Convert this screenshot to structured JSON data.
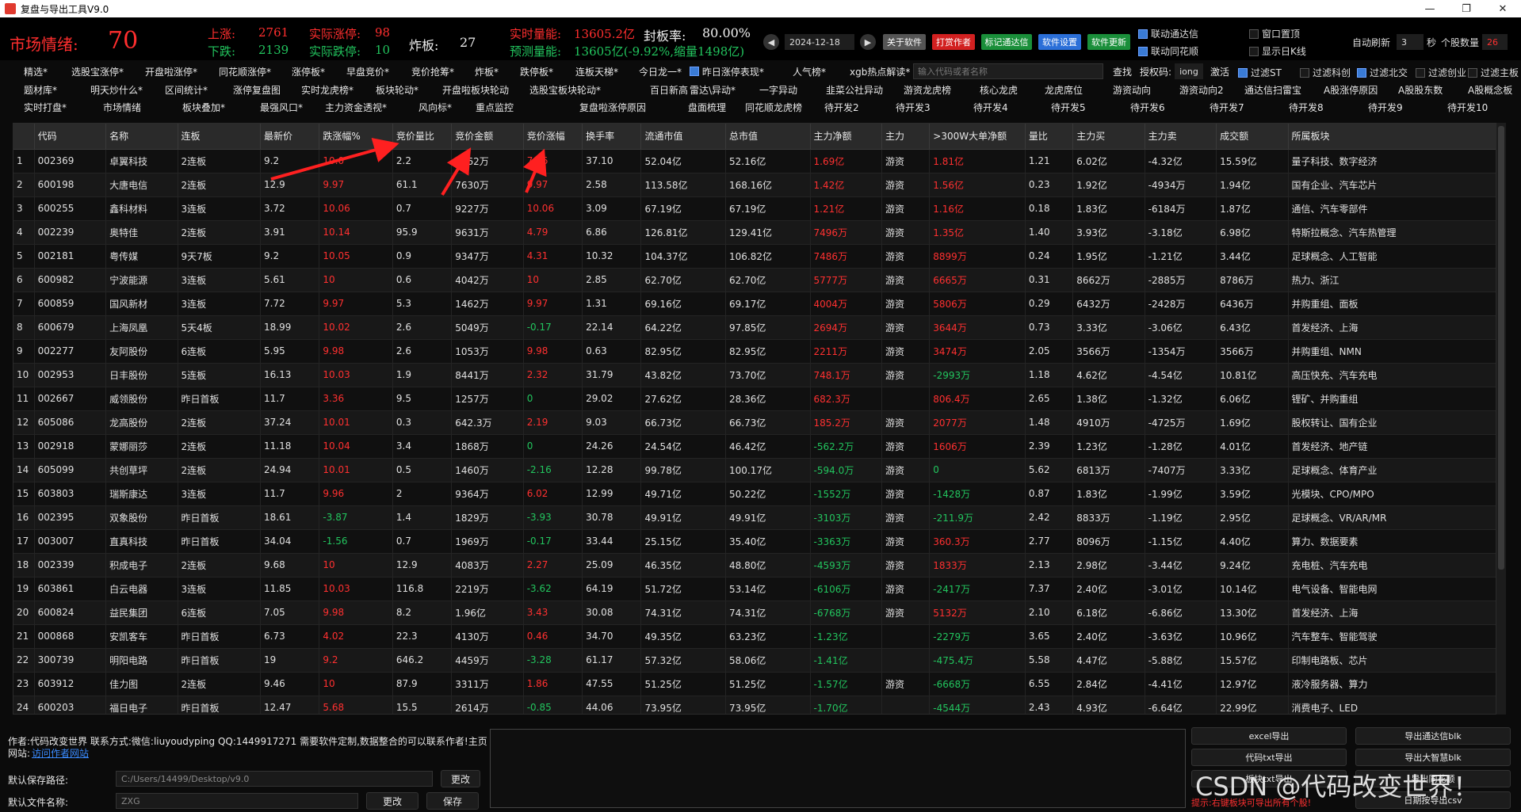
{
  "window": {
    "title": "复盘与导出工具V9.0"
  },
  "header": {
    "mood_label": "市场情绪:",
    "mood_value": "70",
    "rise_label": "上涨:",
    "rise_value": "2761",
    "fall_label": "下跌:",
    "fall_value": "2139",
    "limit_up_label": "实际涨停:",
    "limit_up_value": "98",
    "limit_down_label": "实际跌停:",
    "limit_down_value": "10",
    "broken_label": "炸板:",
    "broken_value": "27",
    "volume_label": "实时量能:",
    "volume_value": "13605.2亿",
    "seal_label": "封板率:",
    "seal_value": "80.00%",
    "forecast_label": "预测量能:",
    "forecast_value": "13605亿(-9.92%,缩量1498亿)",
    "date": "2024-12-18",
    "buttons": [
      "关于软件",
      "打赏作者",
      "标记通达信",
      "软件设置",
      "软件更新"
    ],
    "checks": [
      {
        "label": "联动通达信",
        "on": true
      },
      {
        "label": "联动同花顺",
        "on": true
      },
      {
        "label": "窗口置顶",
        "on": false
      },
      {
        "label": "显示日K线",
        "on": false
      }
    ],
    "auto_refresh_label": "自动刷新",
    "auto_refresh_value": "3",
    "auto_refresh_unit": "秒",
    "stock_count_label": "个股数量",
    "stock_count_value": "26"
  },
  "toolbar1": [
    "精选*",
    "选股宝涨停*",
    "开盘啦涨停*",
    "同花顺涨停*",
    "涨停板*",
    "早盘竞价*",
    "竞价抢筹*",
    "炸板*",
    "跌停板*",
    "连板天梯*",
    "今日龙一*",
    "昨日涨停表现*",
    "人气榜*",
    "xgb热点解读*"
  ],
  "search": {
    "placeholder": "输入代码或者名称",
    "find": "查找",
    "auth_label": "授权码:",
    "auth_value": "iong",
    "activate": "激活"
  },
  "filters": [
    {
      "label": "过滤ST",
      "on": true
    },
    {
      "label": "过滤科创",
      "on": false
    },
    {
      "label": "过滤北交",
      "on": true
    },
    {
      "label": "过滤创业",
      "on": false
    },
    {
      "label": "过滤主板",
      "on": false
    }
  ],
  "toolbar2": [
    "题材库*",
    "明天炒什么*",
    "区间统计*",
    "涨停复盘图",
    "实时龙虎榜*",
    "板块轮动*",
    "开盘啦板块轮动",
    "选股宝板块轮动*",
    "百日新高",
    "雷达\\异动*",
    "一字异动",
    "韭菜公社异动",
    "游资龙虎榜",
    "核心龙虎",
    "龙虎席位",
    "游资动向",
    "游资动向2",
    "通达信扫雷宝",
    "A股涨停原因",
    "A股股东数",
    "A股概念板"
  ],
  "toolbar3": [
    "实时打盘*",
    "市场情绪",
    "板块叠加*",
    "最强风口*",
    "主力资金透视*",
    "风向标*",
    "重点监控",
    "复盘啦涨停原因",
    "盘面梳理",
    "同花顺龙虎榜",
    "待开发2",
    "待开发3",
    "待开发4",
    "待开发5",
    "待开发6",
    "待开发7",
    "待开发8",
    "待开发9",
    "待开发10"
  ],
  "table": {
    "columns": [
      "",
      "代码",
      "名称",
      "连板",
      "最新价",
      "跌涨幅%",
      "竞价量比",
      "竞价金额",
      "竞价涨幅",
      "换手率",
      "流通市值",
      "总市值",
      "主力净额",
      "主力",
      ">300W大单净额",
      "量比",
      "主力买",
      "主力卖",
      "成交额",
      "所属板块"
    ],
    "rows": [
      [
        "1",
        "002369",
        "卓翼科技",
        "2连板",
        "9.2",
        "10.0",
        "2.2",
        "1362万",
        "7.86",
        "37.10",
        "52.04亿",
        "52.16亿",
        "1.69亿",
        "游资",
        "1.81亿",
        "1.21",
        "6.02亿",
        "-4.32亿",
        "15.59亿",
        "量子科技、数字经济"
      ],
      [
        "2",
        "600198",
        "大唐电信",
        "2连板",
        "12.9",
        "9.97",
        "61.1",
        "7630万",
        "9.97",
        "2.58",
        "113.58亿",
        "168.16亿",
        "1.42亿",
        "游资",
        "1.56亿",
        "0.23",
        "1.92亿",
        "-4934万",
        "1.94亿",
        "国有企业、汽车芯片"
      ],
      [
        "3",
        "600255",
        "鑫科材料",
        "3连板",
        "3.72",
        "10.06",
        "0.7",
        "9227万",
        "10.06",
        "3.09",
        "67.19亿",
        "67.19亿",
        "1.21亿",
        "游资",
        "1.16亿",
        "0.18",
        "1.83亿",
        "-6184万",
        "1.87亿",
        "通信、汽车零部件"
      ],
      [
        "4",
        "002239",
        "奥特佳",
        "2连板",
        "3.91",
        "10.14",
        "95.9",
        "9631万",
        "4.79",
        "6.86",
        "126.81亿",
        "129.41亿",
        "7496万",
        "游资",
        "1.35亿",
        "1.40",
        "3.93亿",
        "-3.18亿",
        "6.98亿",
        "特斯拉概念、汽车热管理"
      ],
      [
        "5",
        "002181",
        "粤传媒",
        "9天7板",
        "9.2",
        "10.05",
        "0.9",
        "9347万",
        "4.31",
        "10.32",
        "104.37亿",
        "106.82亿",
        "7486万",
        "游资",
        "8899万",
        "0.24",
        "1.95亿",
        "-1.21亿",
        "3.44亿",
        "足球概念、人工智能"
      ],
      [
        "6",
        "600982",
        "宁波能源",
        "3连板",
        "5.61",
        "10",
        "0.6",
        "4042万",
        "10",
        "2.85",
        "62.70亿",
        "62.70亿",
        "5777万",
        "游资",
        "6665万",
        "0.31",
        "8662万",
        "-2885万",
        "8786万",
        "热力、浙江"
      ],
      [
        "7",
        "600859",
        "国风新材",
        "3连板",
        "7.72",
        "9.97",
        "5.3",
        "1462万",
        "9.97",
        "1.31",
        "69.16亿",
        "69.17亿",
        "4004万",
        "游资",
        "5806万",
        "0.29",
        "6432万",
        "-2428万",
        "6436万",
        "并购重组、面板"
      ],
      [
        "8",
        "600679",
        "上海凤凰",
        "5天4板",
        "18.99",
        "10.02",
        "2.6",
        "5049万",
        "-0.17",
        "22.14",
        "64.22亿",
        "97.85亿",
        "2694万",
        "游资",
        "3644万",
        "0.73",
        "3.33亿",
        "-3.06亿",
        "6.43亿",
        "首发经济、上海"
      ],
      [
        "9",
        "002277",
        "友阿股份",
        "6连板",
        "5.95",
        "9.98",
        "2.6",
        "1053万",
        "9.98",
        "0.63",
        "82.95亿",
        "82.95亿",
        "2211万",
        "游资",
        "3474万",
        "2.05",
        "3566万",
        "-1354万",
        "3566万",
        "并购重组、NMN"
      ],
      [
        "10",
        "002953",
        "日丰股份",
        "5连板",
        "16.13",
        "10.03",
        "1.9",
        "8441万",
        "2.32",
        "31.79",
        "43.82亿",
        "73.70亿",
        "748.1万",
        "游资",
        "-2993万",
        "1.18",
        "4.62亿",
        "-4.54亿",
        "10.81亿",
        "高压快充、汽车充电"
      ],
      [
        "11",
        "002667",
        "威领股份",
        "昨日首板",
        "11.7",
        "3.36",
        "9.5",
        "1257万",
        "0",
        "29.02",
        "27.62亿",
        "28.36亿",
        "682.3万",
        "",
        "806.4万",
        "2.65",
        "1.38亿",
        "-1.32亿",
        "6.06亿",
        "锂矿、并购重组"
      ],
      [
        "12",
        "605086",
        "龙高股份",
        "2连板",
        "37.24",
        "10.01",
        "0.3",
        "642.3万",
        "2.19",
        "9.03",
        "66.73亿",
        "66.73亿",
        "185.2万",
        "游资",
        "2077万",
        "1.48",
        "4910万",
        "-4725万",
        "1.69亿",
        "股权转让、国有企业"
      ],
      [
        "13",
        "002918",
        "蒙娜丽莎",
        "2连板",
        "11.18",
        "10.04",
        "3.4",
        "1868万",
        "0",
        "24.26",
        "24.54亿",
        "46.42亿",
        "-562.2万",
        "游资",
        "1606万",
        "2.39",
        "1.23亿",
        "-1.28亿",
        "4.01亿",
        "首发经济、地产链"
      ],
      [
        "14",
        "605099",
        "共创草坪",
        "2连板",
        "24.94",
        "10.01",
        "0.5",
        "1460万",
        "-2.16",
        "12.28",
        "99.78亿",
        "100.17亿",
        "-594.0万",
        "游资",
        "0",
        "5.62",
        "6813万",
        "-7407万",
        "3.33亿",
        "足球概念、体育产业"
      ],
      [
        "15",
        "603803",
        "瑞斯康达",
        "3连板",
        "11.7",
        "9.96",
        "2",
        "9364万",
        "6.02",
        "12.99",
        "49.71亿",
        "50.22亿",
        "-1552万",
        "游资",
        "-1428万",
        "0.87",
        "1.83亿",
        "-1.99亿",
        "3.59亿",
        "光模块、CPO/MPO"
      ],
      [
        "16",
        "002395",
        "双象股份",
        "昨日首板",
        "18.61",
        "-3.87",
        "1.4",
        "1829万",
        "-3.93",
        "30.78",
        "49.91亿",
        "49.91亿",
        "-3103万",
        "游资",
        "-211.9万",
        "2.42",
        "8833万",
        "-1.19亿",
        "2.95亿",
        "足球概念、VR/AR/MR"
      ],
      [
        "17",
        "003007",
        "直真科技",
        "昨日首板",
        "34.04",
        "-1.56",
        "0.7",
        "1969万",
        "-0.17",
        "33.44",
        "25.15亿",
        "35.40亿",
        "-3363万",
        "游资",
        "360.3万",
        "2.77",
        "8096万",
        "-1.15亿",
        "4.40亿",
        "算力、数据要素"
      ],
      [
        "18",
        "002339",
        "积成电子",
        "2连板",
        "9.68",
        "10",
        "12.9",
        "4083万",
        "2.27",
        "25.09",
        "46.35亿",
        "48.80亿",
        "-4593万",
        "游资",
        "1833万",
        "2.13",
        "2.98亿",
        "-3.44亿",
        "9.24亿",
        "充电桩、汽车充电"
      ],
      [
        "19",
        "603861",
        "白云电器",
        "3连板",
        "11.85",
        "10.03",
        "116.8",
        "2219万",
        "-3.62",
        "64.19",
        "51.72亿",
        "53.14亿",
        "-6106万",
        "游资",
        "-2417万",
        "7.37",
        "2.40亿",
        "-3.01亿",
        "10.14亿",
        "电气设备、智能电网"
      ],
      [
        "20",
        "600824",
        "益民集团",
        "6连板",
        "7.05",
        "9.98",
        "8.2",
        "1.96亿",
        "3.43",
        "30.08",
        "74.31亿",
        "74.31亿",
        "-6768万",
        "游资",
        "5132万",
        "2.10",
        "6.18亿",
        "-6.86亿",
        "13.30亿",
        "首发经济、上海"
      ],
      [
        "21",
        "000868",
        "安凯客车",
        "昨日首板",
        "6.73",
        "4.02",
        "22.3",
        "4130万",
        "0.46",
        "34.70",
        "49.35亿",
        "63.23亿",
        "-1.23亿",
        "",
        "-2279万",
        "3.65",
        "2.40亿",
        "-3.63亿",
        "10.96亿",
        "汽车整车、智能驾驶"
      ],
      [
        "22",
        "300739",
        "明阳电路",
        "昨日首板",
        "19",
        "9.2",
        "646.2",
        "4459万",
        "-3.28",
        "61.17",
        "57.32亿",
        "58.06亿",
        "-1.41亿",
        "",
        "-475.4万",
        "5.58",
        "4.47亿",
        "-5.88亿",
        "15.57亿",
        "印制电路板、芯片"
      ],
      [
        "23",
        "603912",
        "佳力图",
        "2连板",
        "9.46",
        "10",
        "87.9",
        "3311万",
        "1.86",
        "47.55",
        "51.25亿",
        "51.25亿",
        "-1.57亿",
        "游资",
        "-6668万",
        "6.55",
        "2.84亿",
        "-4.41亿",
        "12.97亿",
        "液冷服务器、算力"
      ],
      [
        "24",
        "600203",
        "福日电子",
        "昨日首板",
        "12.47",
        "5.68",
        "15.5",
        "2614万",
        "-0.85",
        "44.06",
        "73.95亿",
        "73.95亿",
        "-1.70亿",
        "",
        "-4544万",
        "2.43",
        "4.93亿",
        "-6.64亿",
        "22.99亿",
        "消费电子、LED"
      ]
    ]
  },
  "footer": {
    "author_line": "作者:代码改变世界 联系方式:微信:liuyoudyping QQ:1449917271 需要软件定制,数据整合的可以联系作者!主页",
    "site_label": "网站:",
    "site_link": "访问作者网站",
    "save_path_label": "默认保存路径:",
    "save_path_value": "C:/Users/14499/Desktop/v9.0",
    "change_btn": "更改",
    "file_name_label": "默认文件名称:",
    "file_name_value": "ZXG",
    "change_btn2": "更改",
    "save_btn": "保存",
    "exports": [
      "excel导出",
      "导出通达信blk",
      "代码txt导出",
      "导出大智慧blk",
      "板块txt导出",
      "导出同花顺",
      "日期按导出csv"
    ],
    "hint": "提示:右键板块可导出所有个股!",
    "watermark": "CSDN @代码改变世界！"
  },
  "colors": {
    "up": "#ff3030",
    "down": "#22c55e",
    "background": "#0b0b0b"
  }
}
